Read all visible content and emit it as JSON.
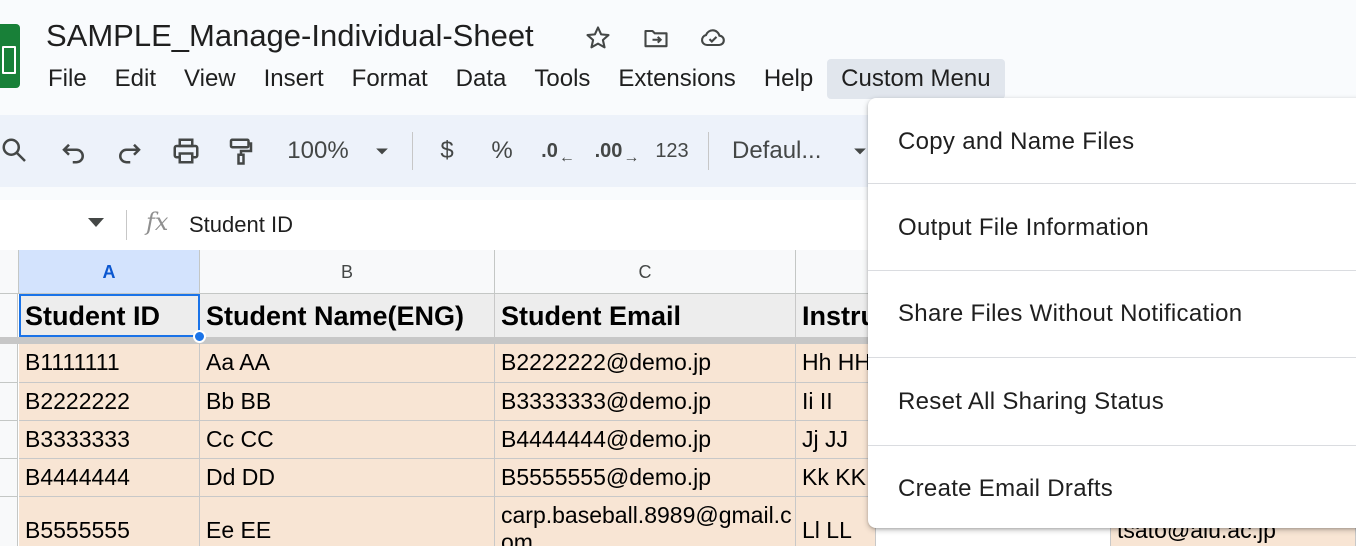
{
  "document": {
    "title": "SAMPLE_Manage-Individual-Sheet"
  },
  "menubar": {
    "items": [
      "File",
      "Edit",
      "View",
      "Insert",
      "Format",
      "Data",
      "Tools",
      "Extensions",
      "Help",
      "Custom Menu"
    ],
    "active": "Custom Menu"
  },
  "toolbar": {
    "zoom": "100%",
    "currency": "$",
    "percent": "%",
    "decrease_decimal": ".0",
    "increase_decimal": ".00",
    "number_format": "123",
    "font": "Defaul..."
  },
  "formula_bar": {
    "fx_label": "fx",
    "content": "Student ID"
  },
  "columns": [
    "A",
    "B",
    "C"
  ],
  "header_row": [
    "Student ID",
    "Student Name(ENG)",
    "Student Email",
    "Instru"
  ],
  "rows": [
    [
      "B1111111",
      "Aa AA",
      "B2222222@demo.jp",
      "Hh HH"
    ],
    [
      "B2222222",
      "Bb BB",
      "B3333333@demo.jp",
      "Ii II"
    ],
    [
      "B3333333",
      "Cc CC",
      "B4444444@demo.jp",
      "Jj JJ"
    ],
    [
      "B4444444",
      "Dd DD",
      "B5555555@demo.jp",
      "Kk KK"
    ],
    [
      "B5555555",
      "Ee EE",
      "carp.baseball.8989@gmail.com",
      "Ll LL"
    ]
  ],
  "partial_right_cell": "tsato@aiu.ac.jp",
  "custom_menu": {
    "items": [
      "Copy and Name Files",
      "Output File Information",
      "Share Files Without Notification",
      "Reset All Sharing Status",
      "Create Email Drafts"
    ]
  },
  "colors": {
    "accent": "#1a73e8",
    "data_fill": "#f8e5d4",
    "header_fill": "#ededed",
    "sheets_green": "#188038"
  }
}
